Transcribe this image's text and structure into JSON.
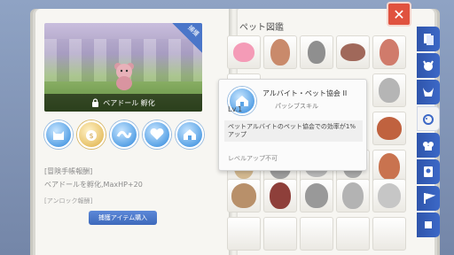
{
  "left_page": {
    "preview": {
      "badge": "捕獲",
      "lock_icon": "lock-icon",
      "pet_label": "ベアドール 孵化"
    },
    "skills": [
      {
        "name": "skill-cat-icon"
      },
      {
        "name": "skill-gold-icon"
      },
      {
        "name": "skill-wave-icon"
      },
      {
        "name": "skill-heart-icon"
      },
      {
        "name": "skill-house-icon"
      }
    ],
    "info_title": "[冒険手帳報酬]",
    "info_text": "ベアドールを孵化,MaxHP+20",
    "info_title2": "[アンロック報酬]",
    "buy_button": "捕獲アイテム購入"
  },
  "right_page": {
    "title": "ペット図鑑",
    "close_label": "✕"
  },
  "tooltip": {
    "name": "アルバイト・ペット協会 II",
    "level": "Lv.1",
    "type": "パッシブスキル",
    "description": "ペットアルバイトのペット協会での効率が1%アップ",
    "footer": "レベルアップ不可"
  },
  "side_tabs": [
    {
      "icon": "cards-icon"
    },
    {
      "icon": "demon-icon"
    },
    {
      "icon": "horns-icon"
    },
    {
      "icon": "pet-icon",
      "active": true
    },
    {
      "icon": "chef-icon"
    },
    {
      "icon": "badge-icon"
    },
    {
      "icon": "flag-icon"
    },
    {
      "icon": "blank-icon"
    }
  ],
  "colors": {
    "accent_blue": "#3c68c7",
    "close_red": "#e0523f",
    "page": "#f7f6f2"
  }
}
